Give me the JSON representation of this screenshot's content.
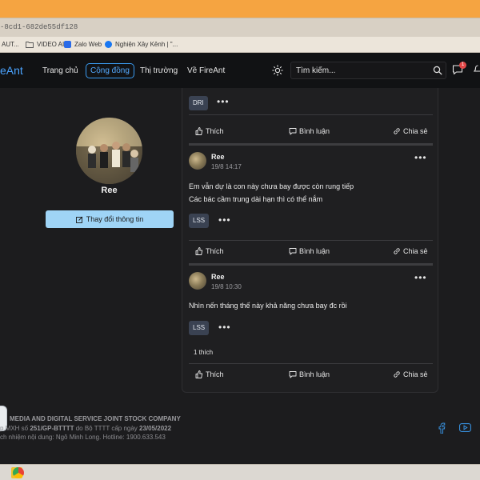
{
  "browser": {
    "url_fragment": "-8cd1-682de55df128",
    "bookmarks": [
      {
        "label": "AUT...",
        "icon": "bookmark-icon"
      },
      {
        "label": "VIDEO AI",
        "icon": "folder-icon"
      },
      {
        "label": "Zalo Web",
        "icon": "zalo-icon"
      },
      {
        "label": "Nghiện Xây Kênh | \"...",
        "icon": "facebook-icon"
      }
    ]
  },
  "nav": {
    "logo": "eAnt",
    "items": [
      "Trang chủ",
      "Cộng đồng",
      "Thị trường",
      "Về FireAnt"
    ],
    "active_index": 1,
    "search_placeholder": "Tìm kiếm...",
    "notification_count": "1"
  },
  "profile": {
    "name": "Ree",
    "edit_button": "Thay đổi thông tin"
  },
  "feed": {
    "top_tag": "DRI",
    "actions": {
      "like": "Thích",
      "comment": "Bình luận",
      "share": "Chia sẻ"
    },
    "posts": [
      {
        "author": "Ree",
        "time": "19/8 14:17",
        "lines": [
          "Em vẫn dự là con này chưa bay được còn rung tiếp",
          "Các bác cầm trung dài hạn thì có thể nắm"
        ],
        "tag": "LSS",
        "likes": ""
      },
      {
        "author": "Ree",
        "time": "19/8 10:30",
        "lines": [
          "Nhìn nến tháng thế này khả năng chưa bay đc rồi"
        ],
        "tag": "LSS",
        "likes": "1 thích"
      }
    ]
  },
  "footer": {
    "company": "MEDIA AND DIGITAL SERVICE JOINT STOCK COMPANY",
    "license_prefix": "p MXH số",
    "license_no": "251/GP-BTTTT",
    "license_mid": "do Bộ TTTT cấp ngày",
    "license_date": "23/05/2022",
    "responsible": "ch nhiệm nội dung: Ngô Minh Long. Hotline: 1900.633.543"
  },
  "colors": {
    "accent": "#4aa3ff",
    "tag_bg": "#3a4252",
    "edit_btn": "#9fd4f6",
    "browser_top": "#f5a441"
  }
}
